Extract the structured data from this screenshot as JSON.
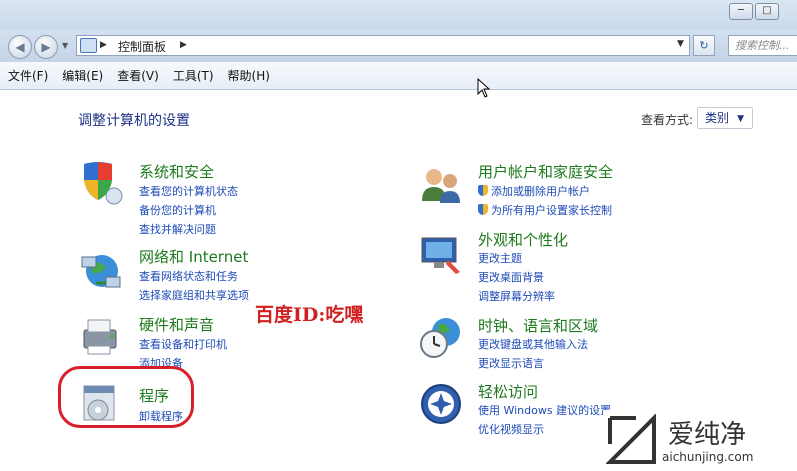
{
  "window": {
    "min": "─",
    "max": "□"
  },
  "address": {
    "breadcrumb": "控制面板",
    "search_placeholder": "搜索控制..."
  },
  "menu": [
    "文件(F)",
    "编辑(E)",
    "查看(V)",
    "工具(T)",
    "帮助(H)"
  ],
  "main": {
    "heading": "调整计算机的设置",
    "view_label": "查看方式:",
    "view_value": "类别",
    "left_categories": [
      {
        "title": "系统和安全",
        "icon": "shield-icon",
        "links": [
          "查看您的计算机状态",
          "备份您的计算机",
          "查找并解决问题"
        ]
      },
      {
        "title": "网络和 Internet",
        "icon": "network-icon",
        "links": [
          "查看网络状态和任务",
          "选择家庭组和共享选项"
        ]
      },
      {
        "title": "硬件和声音",
        "icon": "printer-icon",
        "links": [
          "查看设备和打印机",
          "添加设备"
        ]
      },
      {
        "title": "程序",
        "icon": "programs-icon",
        "links": [
          "卸载程序"
        ]
      }
    ],
    "right_categories": [
      {
        "title": "用户帐户和家庭安全",
        "icon": "users-icon",
        "links": [
          "添加或删除用户帐户",
          "为所有用户设置家长控制"
        ]
      },
      {
        "title": "外观和个性化",
        "icon": "appearance-icon",
        "links": [
          "更改主题",
          "更改桌面背景",
          "调整屏幕分辨率"
        ]
      },
      {
        "title": "时钟、语言和区域",
        "icon": "clock-globe-icon",
        "links": [
          "更改键盘或其他输入法",
          "更改显示语言"
        ]
      },
      {
        "title": "轻松访问",
        "icon": "accessibility-icon",
        "links": [
          "使用 Windows 建议的设置",
          "优化视频显示"
        ]
      }
    ]
  },
  "overlay": {
    "watermark": "百度ID:吃嘿",
    "logo_text": "爱纯净",
    "logo_url": "aichunjing.com"
  },
  "colors": {
    "category_title": "#1e7a1e",
    "link": "#1e4bb8",
    "heading": "#1e3287",
    "highlight": "#d8202a"
  }
}
